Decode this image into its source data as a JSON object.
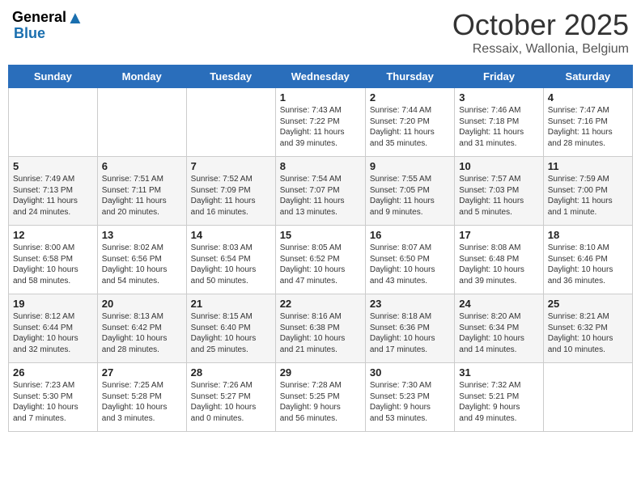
{
  "header": {
    "logo_line1": "General",
    "logo_line2": "Blue",
    "month": "October 2025",
    "location": "Ressaix, Wallonia, Belgium"
  },
  "days_of_week": [
    "Sunday",
    "Monday",
    "Tuesday",
    "Wednesday",
    "Thursday",
    "Friday",
    "Saturday"
  ],
  "weeks": [
    [
      {
        "day": "",
        "info": ""
      },
      {
        "day": "",
        "info": ""
      },
      {
        "day": "",
        "info": ""
      },
      {
        "day": "1",
        "info": "Sunrise: 7:43 AM\nSunset: 7:22 PM\nDaylight: 11 hours\nand 39 minutes."
      },
      {
        "day": "2",
        "info": "Sunrise: 7:44 AM\nSunset: 7:20 PM\nDaylight: 11 hours\nand 35 minutes."
      },
      {
        "day": "3",
        "info": "Sunrise: 7:46 AM\nSunset: 7:18 PM\nDaylight: 11 hours\nand 31 minutes."
      },
      {
        "day": "4",
        "info": "Sunrise: 7:47 AM\nSunset: 7:16 PM\nDaylight: 11 hours\nand 28 minutes."
      }
    ],
    [
      {
        "day": "5",
        "info": "Sunrise: 7:49 AM\nSunset: 7:13 PM\nDaylight: 11 hours\nand 24 minutes."
      },
      {
        "day": "6",
        "info": "Sunrise: 7:51 AM\nSunset: 7:11 PM\nDaylight: 11 hours\nand 20 minutes."
      },
      {
        "day": "7",
        "info": "Sunrise: 7:52 AM\nSunset: 7:09 PM\nDaylight: 11 hours\nand 16 minutes."
      },
      {
        "day": "8",
        "info": "Sunrise: 7:54 AM\nSunset: 7:07 PM\nDaylight: 11 hours\nand 13 minutes."
      },
      {
        "day": "9",
        "info": "Sunrise: 7:55 AM\nSunset: 7:05 PM\nDaylight: 11 hours\nand 9 minutes."
      },
      {
        "day": "10",
        "info": "Sunrise: 7:57 AM\nSunset: 7:03 PM\nDaylight: 11 hours\nand 5 minutes."
      },
      {
        "day": "11",
        "info": "Sunrise: 7:59 AM\nSunset: 7:00 PM\nDaylight: 11 hours\nand 1 minute."
      }
    ],
    [
      {
        "day": "12",
        "info": "Sunrise: 8:00 AM\nSunset: 6:58 PM\nDaylight: 10 hours\nand 58 minutes."
      },
      {
        "day": "13",
        "info": "Sunrise: 8:02 AM\nSunset: 6:56 PM\nDaylight: 10 hours\nand 54 minutes."
      },
      {
        "day": "14",
        "info": "Sunrise: 8:03 AM\nSunset: 6:54 PM\nDaylight: 10 hours\nand 50 minutes."
      },
      {
        "day": "15",
        "info": "Sunrise: 8:05 AM\nSunset: 6:52 PM\nDaylight: 10 hours\nand 47 minutes."
      },
      {
        "day": "16",
        "info": "Sunrise: 8:07 AM\nSunset: 6:50 PM\nDaylight: 10 hours\nand 43 minutes."
      },
      {
        "day": "17",
        "info": "Sunrise: 8:08 AM\nSunset: 6:48 PM\nDaylight: 10 hours\nand 39 minutes."
      },
      {
        "day": "18",
        "info": "Sunrise: 8:10 AM\nSunset: 6:46 PM\nDaylight: 10 hours\nand 36 minutes."
      }
    ],
    [
      {
        "day": "19",
        "info": "Sunrise: 8:12 AM\nSunset: 6:44 PM\nDaylight: 10 hours\nand 32 minutes."
      },
      {
        "day": "20",
        "info": "Sunrise: 8:13 AM\nSunset: 6:42 PM\nDaylight: 10 hours\nand 28 minutes."
      },
      {
        "day": "21",
        "info": "Sunrise: 8:15 AM\nSunset: 6:40 PM\nDaylight: 10 hours\nand 25 minutes."
      },
      {
        "day": "22",
        "info": "Sunrise: 8:16 AM\nSunset: 6:38 PM\nDaylight: 10 hours\nand 21 minutes."
      },
      {
        "day": "23",
        "info": "Sunrise: 8:18 AM\nSunset: 6:36 PM\nDaylight: 10 hours\nand 17 minutes."
      },
      {
        "day": "24",
        "info": "Sunrise: 8:20 AM\nSunset: 6:34 PM\nDaylight: 10 hours\nand 14 minutes."
      },
      {
        "day": "25",
        "info": "Sunrise: 8:21 AM\nSunset: 6:32 PM\nDaylight: 10 hours\nand 10 minutes."
      }
    ],
    [
      {
        "day": "26",
        "info": "Sunrise: 7:23 AM\nSunset: 5:30 PM\nDaylight: 10 hours\nand 7 minutes."
      },
      {
        "day": "27",
        "info": "Sunrise: 7:25 AM\nSunset: 5:28 PM\nDaylight: 10 hours\nand 3 minutes."
      },
      {
        "day": "28",
        "info": "Sunrise: 7:26 AM\nSunset: 5:27 PM\nDaylight: 10 hours\nand 0 minutes."
      },
      {
        "day": "29",
        "info": "Sunrise: 7:28 AM\nSunset: 5:25 PM\nDaylight: 9 hours\nand 56 minutes."
      },
      {
        "day": "30",
        "info": "Sunrise: 7:30 AM\nSunset: 5:23 PM\nDaylight: 9 hours\nand 53 minutes."
      },
      {
        "day": "31",
        "info": "Sunrise: 7:32 AM\nSunset: 5:21 PM\nDaylight: 9 hours\nand 49 minutes."
      },
      {
        "day": "",
        "info": ""
      }
    ]
  ]
}
